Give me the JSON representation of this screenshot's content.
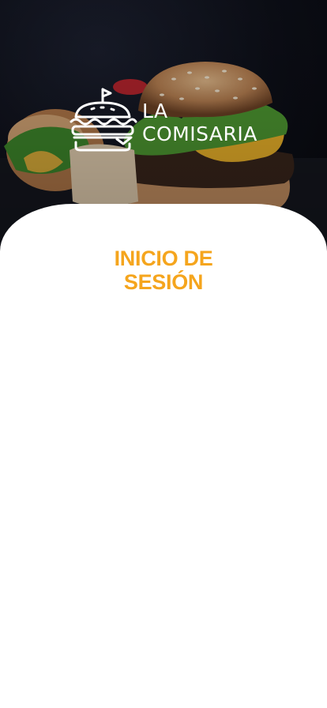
{
  "brand": {
    "line1": "LA",
    "line2": "COMISARIA",
    "logo_icon": "burger-with-flag-icon"
  },
  "login": {
    "title_line1": "INICIO DE",
    "title_line2": "SESIÓN"
  },
  "colors": {
    "accent": "#f5a51d",
    "hero_background": "#0d0f18",
    "card_background": "#ffffff"
  }
}
